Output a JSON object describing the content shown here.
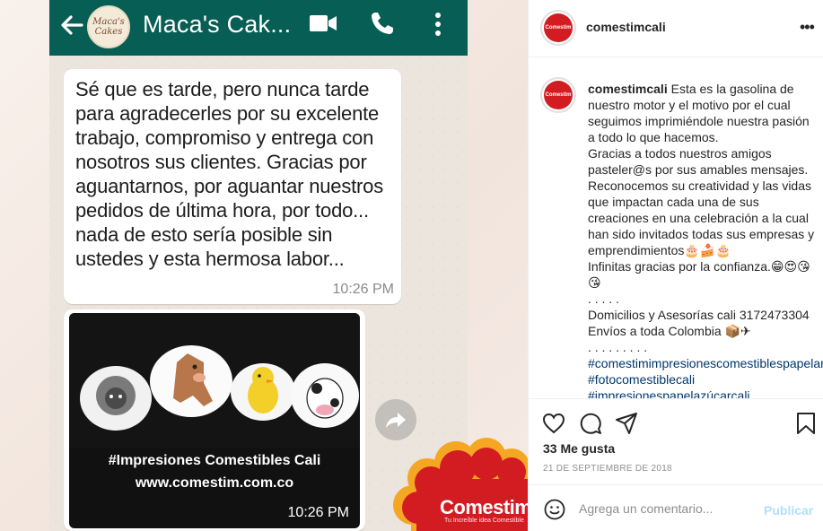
{
  "post_image": {
    "chat_title": "Maca's Cak...",
    "avatar_text": "Maca's Cakes",
    "message": "Sé que es tarde, pero nunca tarde para agradecerles por su excelente trabajo, compromiso y entrega con nosotros sus clientes. Gracias por aguantarnos, por aguantar nuestros pedidos de última hora, por todo... nada de esto sería posible sin ustedes y esta hermosa labor...",
    "message_time": "10:26 PM",
    "image_caption": "#Impresiones Comestibles Cali",
    "image_url": "www.comestim.com.co",
    "image_time": "10:26 PM",
    "brand_name": "Comestim",
    "brand_tagline": "Tu Increíble idea Comestible",
    "colors": {
      "whatsapp_header": "#075e54",
      "brand_red": "#d31b22",
      "brand_yellow": "#f5a623"
    }
  },
  "instagram": {
    "username": "comestimcali",
    "more_icon": "ellipsis-icon",
    "caption": {
      "user": "comestimcali",
      "lines": [
        "Esta es la gasolina de nuestro motor y el motivo por el cual seguimos imprimiéndole nuestra pasión a todo lo que hacemos.",
        "Gracias a todos nuestros amigos pasteler@s por sus amables mensajes.",
        "Reconocemos su creatividad y las vidas que impactan cada una de sus creaciones en una celebración a la cual han sido invitados todas sus empresas y emprendimientos🎂🍰🎂",
        "Infinitas gracias por la confianza.😁😍😘😘",
        ". . . . .",
        "Domicilios y Asesorías cali 3172473304",
        "Envíos a toda Colombia 📦✈",
        ". . . . . . . . ."
      ],
      "hashtags": [
        "#comestimimpresionescomestiblespapelarroz",
        "#fotocomestiblecali",
        "#impresionespapelazúcarcali"
      ]
    },
    "likes": "33 Me gusta",
    "date": "21 DE SEPTIEMBRE DE 2018",
    "comment_placeholder": "Agrega un comentario...",
    "publish_label": "Publicar",
    "colors": {
      "link": "#00376b",
      "publish_disabled": "#b2dffc",
      "muted": "#8e8e8e"
    }
  }
}
